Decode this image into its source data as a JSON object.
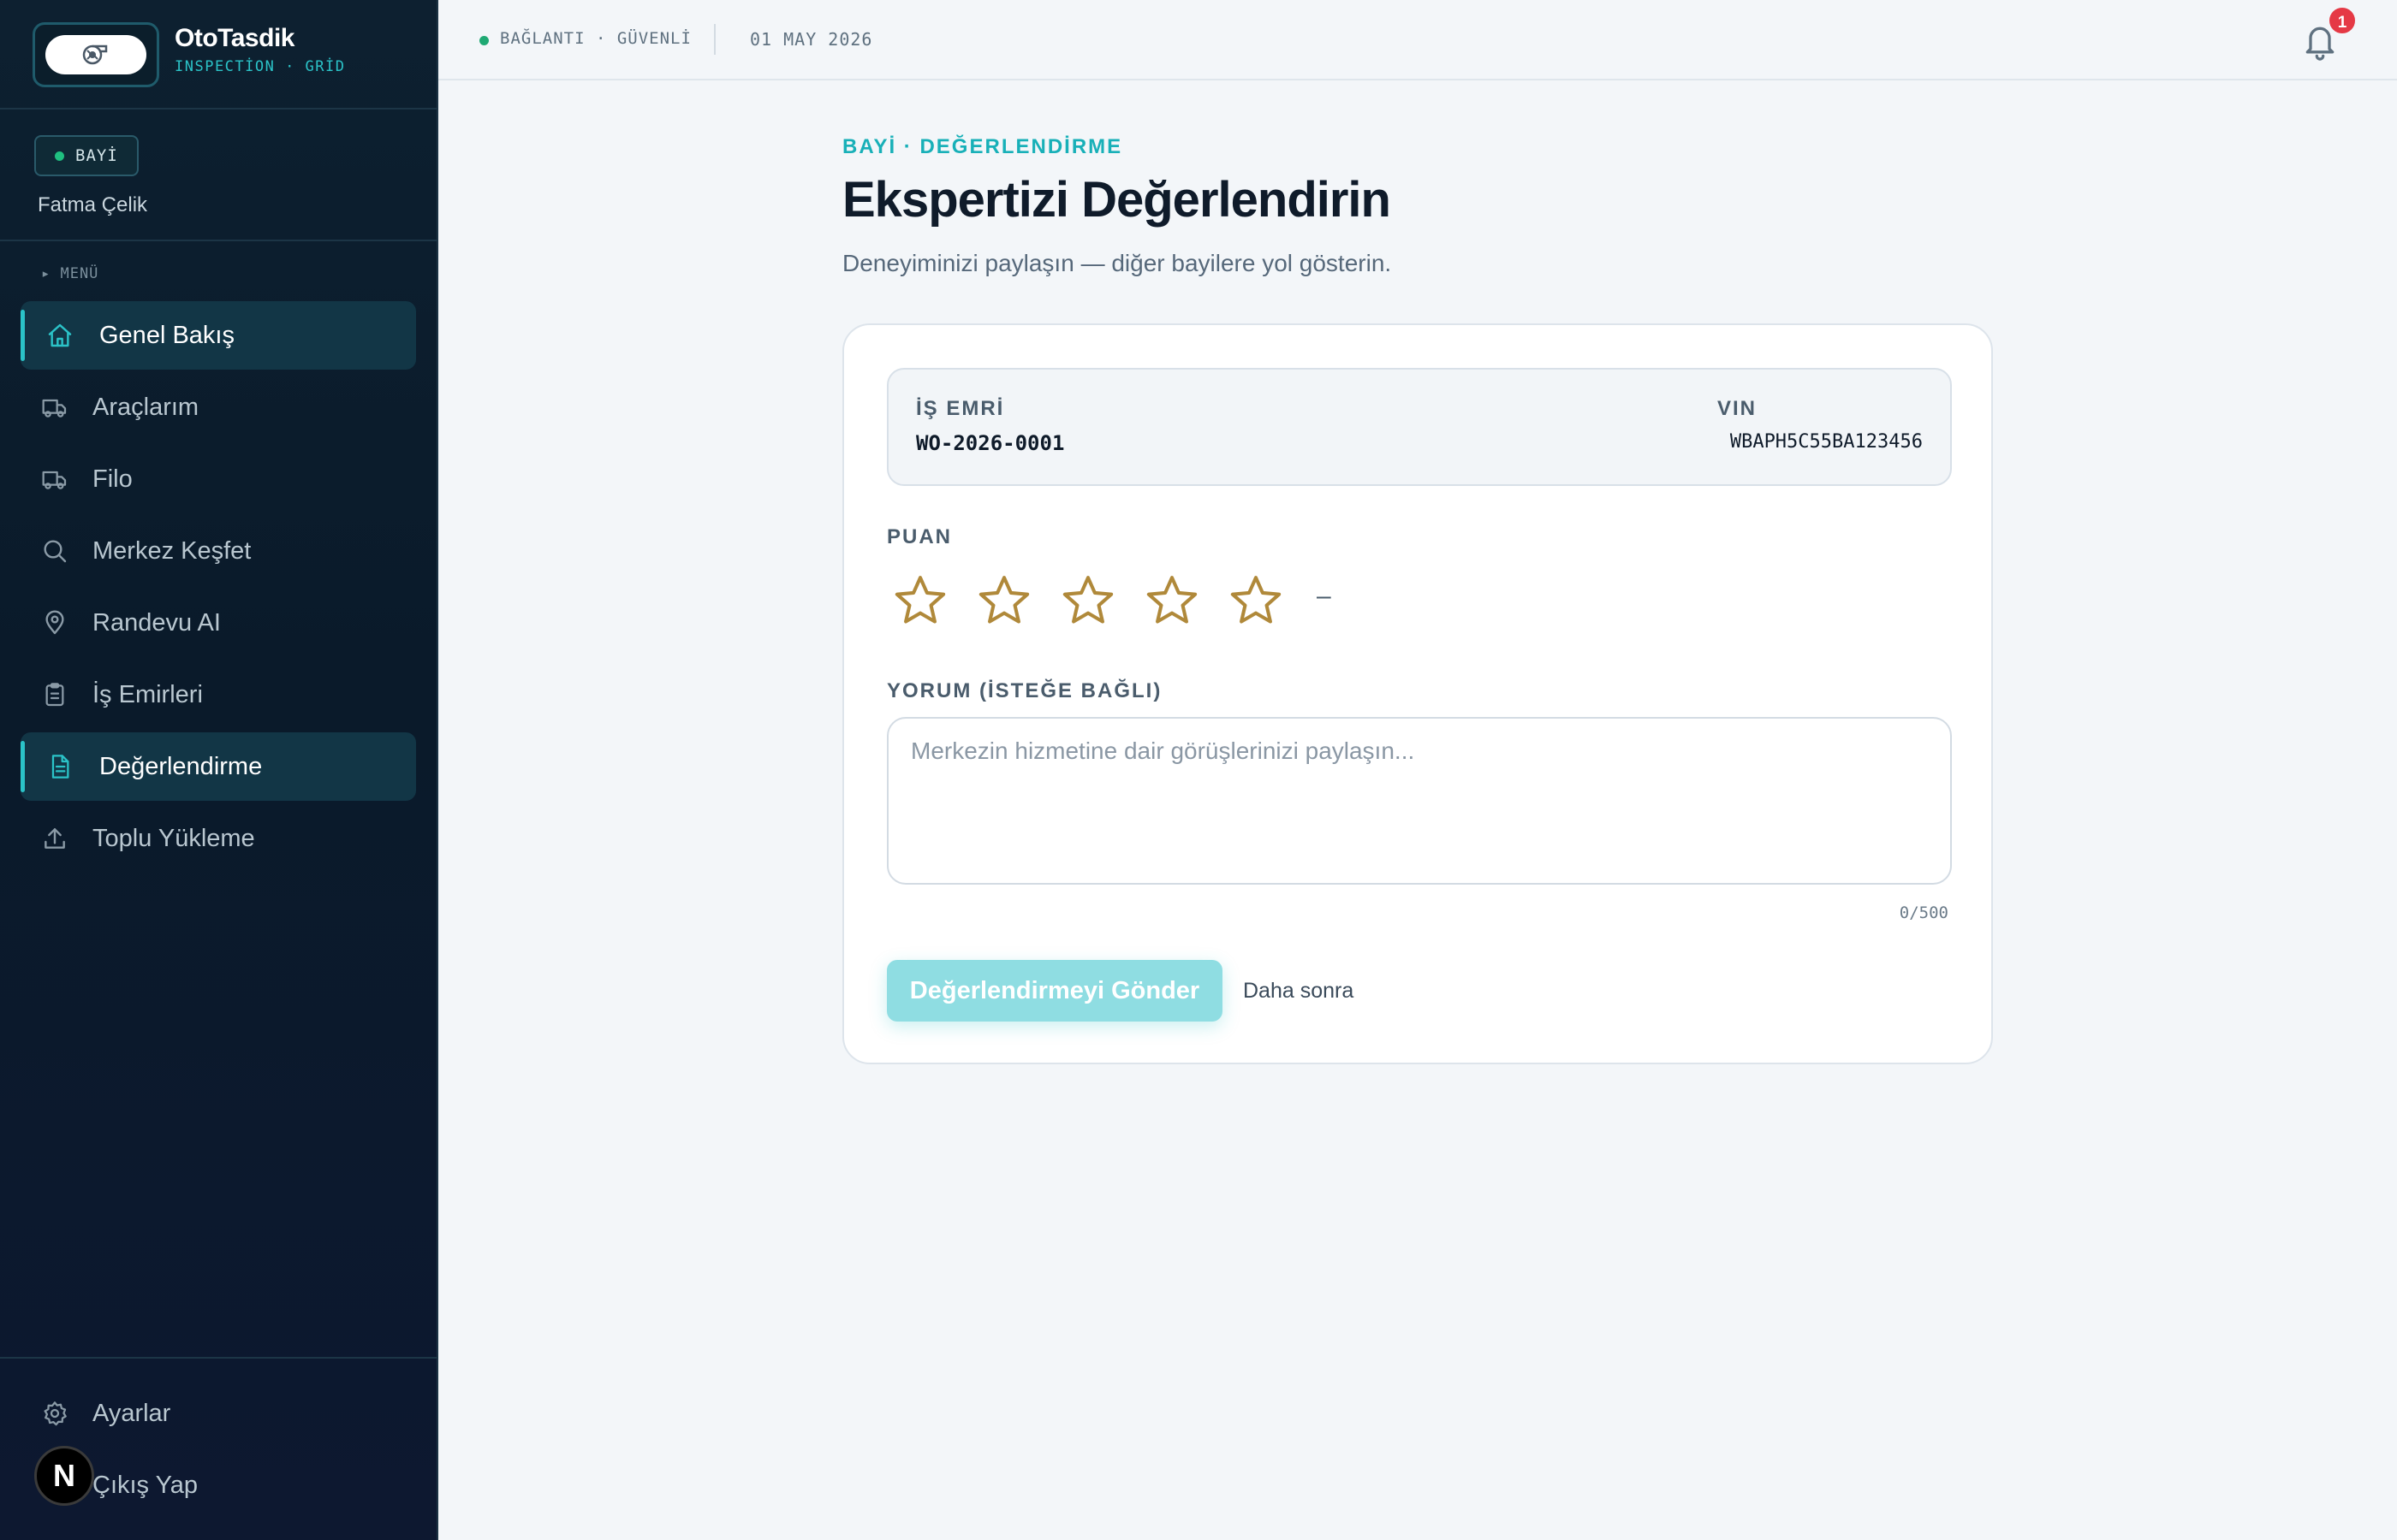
{
  "brand": {
    "name": "OtoTasdik",
    "subtitle": "INSPECTİON · GRİD"
  },
  "user": {
    "role": "BAYİ",
    "name": "Fatma Çelik"
  },
  "sidebar": {
    "menu_label": "▸ MENÜ",
    "items": [
      {
        "label": "Genel Bakış",
        "icon": "home-icon",
        "active": true
      },
      {
        "label": "Araçlarım",
        "icon": "truck-icon",
        "active": false
      },
      {
        "label": "Filo",
        "icon": "truck-icon",
        "active": false
      },
      {
        "label": "Merkez Keşfet",
        "icon": "search-icon",
        "active": false
      },
      {
        "label": "Randevu AI",
        "icon": "map-pin-icon",
        "active": false
      },
      {
        "label": "İş Emirleri",
        "icon": "clipboard-icon",
        "active": false
      },
      {
        "label": "Değerlendirme",
        "icon": "document-icon",
        "active": true
      },
      {
        "label": "Toplu Yükleme",
        "icon": "upload-icon",
        "active": false
      }
    ],
    "bottom": [
      {
        "label": "Ayarlar",
        "icon": "gear-icon"
      },
      {
        "label": "Çıkış Yap",
        "icon": "logout-icon"
      }
    ],
    "avatar_initial": "N"
  },
  "topbar": {
    "status": "BAĞLANTI · GÜVENLİ",
    "date": "01 MAY 2026",
    "notification_count": "1"
  },
  "page": {
    "eyebrow": "BAYİ · DEĞERLENDİRME",
    "title": "Ekspertizi Değerlendirin",
    "subtitle": "Deneyiminizi paylaşın — diğer bayilere yol gösterin."
  },
  "form": {
    "work_order_label": "İŞ EMRİ",
    "work_order_value": "WO-2026-0001",
    "vin_label": "VIN",
    "vin_value": "WBAPH5C55BA123456",
    "rating_label": "PUAN",
    "rating_max": 5,
    "rating_value": 0,
    "rating_display": "–",
    "comment_label": "YORUM (İSTEĞE BAĞLI)",
    "comment_placeholder": "Merkezin hizmetine dair görüşlerinizi paylaşın...",
    "comment_value": "",
    "counter": "0/500",
    "submit_label": "Değerlendirmeyi Gönder",
    "later_label": "Daha sonra"
  },
  "colors": {
    "accent": "#2bc3c8",
    "star": "#b0893a",
    "sidebar_bg": "#0d2030",
    "badge": "#e53945",
    "status_ok": "#1fa974"
  }
}
